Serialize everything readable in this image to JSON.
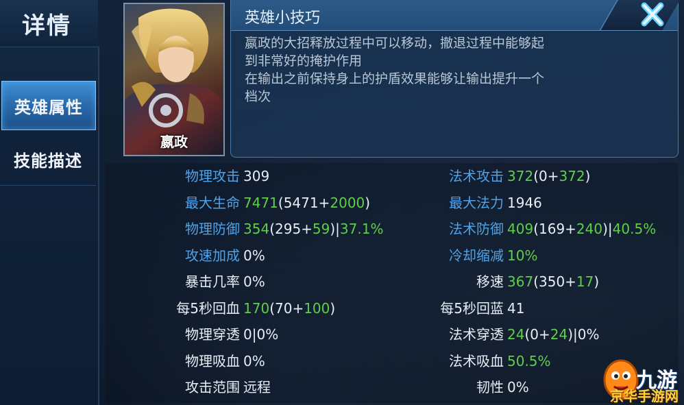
{
  "window": {
    "title": "详情"
  },
  "sidebar": {
    "tabs": [
      {
        "label": "英雄属性",
        "active": true
      },
      {
        "label": "技能描述",
        "active": false
      }
    ]
  },
  "hero": {
    "name": "嬴政",
    "portrait_icon": "hero-portrait-icon"
  },
  "tips": {
    "title": "英雄小技巧",
    "lines": [
      "嬴政的大招释放过程中可以移动，撤退过程中能够起",
      "到非常好的掩护作用",
      "在输出之前保持身上的护盾效果能够让输出提升一个",
      "档次"
    ],
    "close_icon": "close-icon"
  },
  "stats_left": [
    {
      "label": "物理攻击",
      "label_color": "blue",
      "parts": [
        {
          "t": "309",
          "c": "white"
        }
      ]
    },
    {
      "label": "最大生命",
      "label_color": "blue",
      "parts": [
        {
          "t": "7471",
          "c": "green"
        },
        {
          "t": "(5471+",
          "c": "white"
        },
        {
          "t": "2000",
          "c": "green"
        },
        {
          "t": ")",
          "c": "white"
        }
      ]
    },
    {
      "label": "物理防御",
      "label_color": "blue",
      "parts": [
        {
          "t": "354",
          "c": "green"
        },
        {
          "t": "(295+",
          "c": "white"
        },
        {
          "t": "59",
          "c": "green"
        },
        {
          "t": ")|",
          "c": "white"
        },
        {
          "t": "37.1%",
          "c": "green"
        }
      ]
    },
    {
      "label": "攻速加成",
      "label_color": "blue",
      "parts": [
        {
          "t": "0%",
          "c": "white"
        }
      ]
    },
    {
      "label": "暴击几率",
      "label_color": "white",
      "parts": [
        {
          "t": "0%",
          "c": "white"
        }
      ]
    },
    {
      "label": "每5秒回血",
      "label_color": "white",
      "parts": [
        {
          "t": "170",
          "c": "green"
        },
        {
          "t": "(70+",
          "c": "white"
        },
        {
          "t": "100",
          "c": "green"
        },
        {
          "t": ")",
          "c": "white"
        }
      ]
    },
    {
      "label": "物理穿透",
      "label_color": "white",
      "parts": [
        {
          "t": "0|0%",
          "c": "white"
        }
      ]
    },
    {
      "label": "物理吸血",
      "label_color": "white",
      "parts": [
        {
          "t": "0%",
          "c": "white"
        }
      ]
    },
    {
      "label": "攻击范围",
      "label_color": "white",
      "parts": [
        {
          "t": "远程",
          "c": "white"
        }
      ]
    }
  ],
  "stats_right": [
    {
      "label": "法术攻击",
      "label_color": "blue",
      "parts": [
        {
          "t": "372",
          "c": "green"
        },
        {
          "t": "(0+",
          "c": "white"
        },
        {
          "t": "372",
          "c": "green"
        },
        {
          "t": ")",
          "c": "white"
        }
      ]
    },
    {
      "label": "最大法力",
      "label_color": "blue",
      "parts": [
        {
          "t": "1946",
          "c": "white"
        }
      ]
    },
    {
      "label": "法术防御",
      "label_color": "blue",
      "parts": [
        {
          "t": "409",
          "c": "green"
        },
        {
          "t": "(169+",
          "c": "white"
        },
        {
          "t": "240",
          "c": "green"
        },
        {
          "t": ")|",
          "c": "white"
        },
        {
          "t": "40.5%",
          "c": "green"
        }
      ]
    },
    {
      "label": "冷却缩减",
      "label_color": "blue",
      "parts": [
        {
          "t": "10%",
          "c": "green"
        }
      ]
    },
    {
      "label": "移速",
      "label_color": "white",
      "parts": [
        {
          "t": "367",
          "c": "green"
        },
        {
          "t": "(350+",
          "c": "white"
        },
        {
          "t": "17",
          "c": "green"
        },
        {
          "t": ")",
          "c": "white"
        }
      ]
    },
    {
      "label": "每5秒回蓝",
      "label_color": "white",
      "parts": [
        {
          "t": "41",
          "c": "white"
        }
      ]
    },
    {
      "label": "法术穿透",
      "label_color": "white",
      "parts": [
        {
          "t": "24",
          "c": "green"
        },
        {
          "t": "(0+",
          "c": "white"
        },
        {
          "t": "24",
          "c": "green"
        },
        {
          "t": ")|0%",
          "c": "white"
        }
      ]
    },
    {
      "label": "法术吸血",
      "label_color": "white",
      "parts": [
        {
          "t": "50.5%",
          "c": "green"
        }
      ]
    },
    {
      "label": "韧性",
      "label_color": "white",
      "parts": [
        {
          "t": "0%",
          "c": "white"
        }
      ]
    }
  ],
  "watermark": {
    "text": "九游",
    "sub": "京华手游网",
    "icon": "watermark-mascot-icon"
  },
  "colors": {
    "blue_label": "#4ea3ea",
    "green_value": "#5fcf4a",
    "white": "#e8eef5",
    "accent": "#2767a8"
  }
}
